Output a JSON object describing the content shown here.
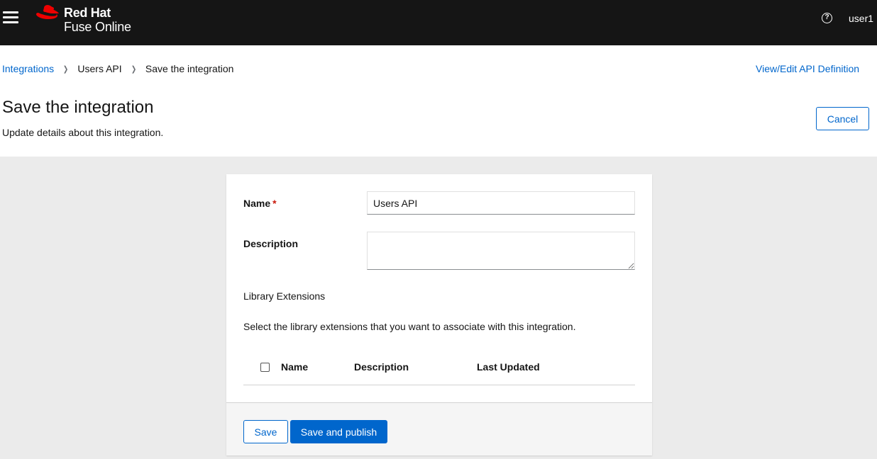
{
  "masthead": {
    "brand_line1": "Red Hat",
    "brand_line2": "Fuse Online",
    "help_icon": "question-circle-icon",
    "user": "user1"
  },
  "breadcrumb": {
    "items": [
      "Integrations",
      "Users API",
      "Save the integration"
    ]
  },
  "header": {
    "api_link": "View/Edit API Definition",
    "title": "Save the integration",
    "subtitle": "Update details about this integration.",
    "cancel_label": "Cancel"
  },
  "form": {
    "name_label": "Name",
    "required_marker": "*",
    "name_value": "Users API",
    "description_label": "Description",
    "description_value": "",
    "extensions_heading": "Library Extensions",
    "extensions_help": "Select the library extensions that you want to associate with this integration.",
    "table_columns": [
      "Name",
      "Description",
      "Last Updated"
    ]
  },
  "footer": {
    "save_label": "Save",
    "publish_label": "Save and publish"
  },
  "colors": {
    "masthead_bg": "#151515",
    "link": "#0066cc",
    "primary": "#0066cc",
    "required": "#c9190b",
    "logo_red": "#ee0000"
  }
}
